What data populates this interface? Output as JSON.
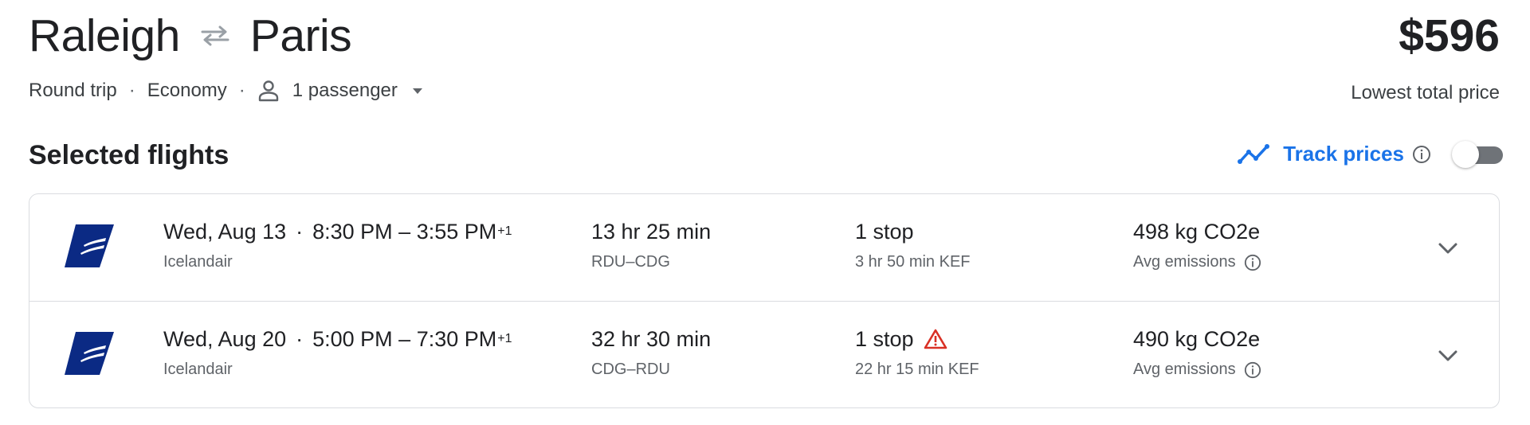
{
  "header": {
    "origin": "Raleigh",
    "destination": "Paris",
    "swap_icon": "swap-arrows-icon",
    "price": "$596",
    "price_caption": "Lowest total price"
  },
  "options": {
    "trip_type": "Round trip",
    "cabin": "Economy",
    "passengers": "1 passenger",
    "separator": "·"
  },
  "section": {
    "title": "Selected flights",
    "track_label": "Track prices",
    "track_enabled": false
  },
  "colors": {
    "accent": "#1a73e8",
    "warning": "#d93025",
    "airline_logo": "#0b2a84"
  },
  "flights": [
    {
      "date": "Wed, Aug 13",
      "times": "8:30 PM – 3:55 PM",
      "day_offset": "+1",
      "airline": "Icelandair",
      "duration": "13 hr 25 min",
      "route": "RDU–CDG",
      "stops": "1 stop",
      "layover": "3 hr 50 min KEF",
      "warning": false,
      "emissions": "498 kg CO2e",
      "emissions_label": "Avg emissions"
    },
    {
      "date": "Wed, Aug 20",
      "times": "5:00 PM – 7:30 PM",
      "day_offset": "+1",
      "airline": "Icelandair",
      "duration": "32 hr 30 min",
      "route": "CDG–RDU",
      "stops": "1 stop",
      "layover": "22 hr 15 min KEF",
      "warning": true,
      "emissions": "490 kg CO2e",
      "emissions_label": "Avg emissions"
    }
  ]
}
